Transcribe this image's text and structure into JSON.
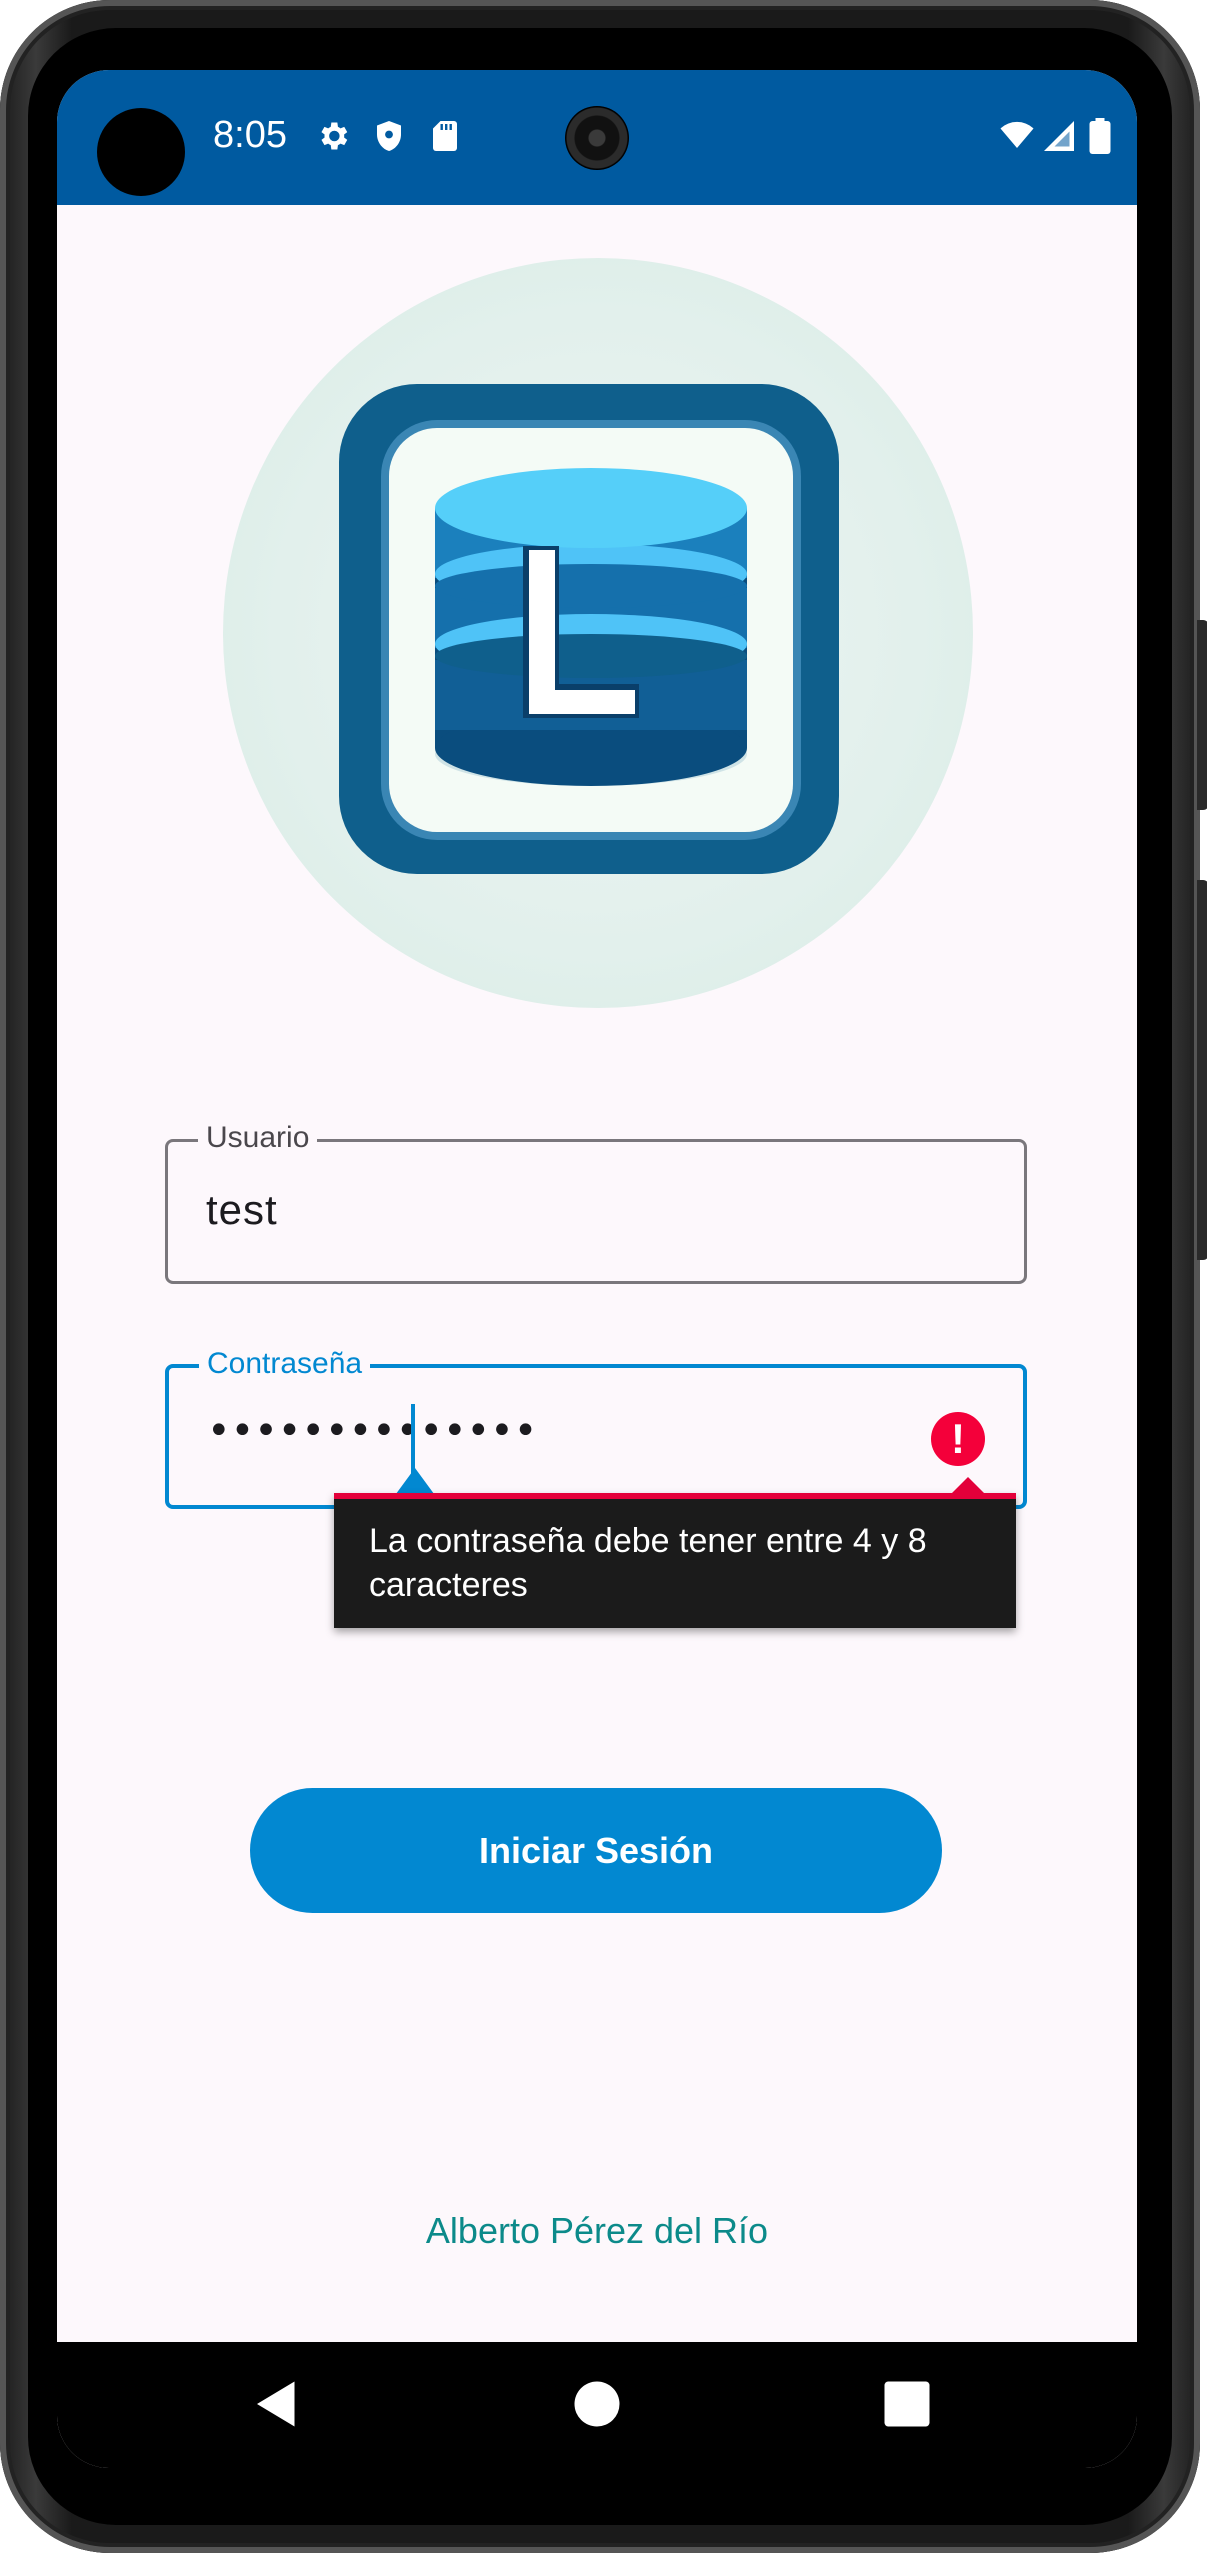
{
  "status_bar": {
    "time": "8:05",
    "left_icons": [
      "settings-icon",
      "shield-icon",
      "sd-card-icon"
    ],
    "right_icons": [
      "wifi-icon",
      "signal-icon",
      "battery-icon"
    ]
  },
  "logo": {
    "letter": "L",
    "description_icon": "database-icon"
  },
  "form": {
    "username": {
      "label": "Usuario",
      "value": "test"
    },
    "password": {
      "label": "Contraseña",
      "value": "••••••••••••••"
    },
    "error_message": "La contraseña debe tener entre 4 y 8 caracteres"
  },
  "login_button": {
    "label": "Iniciar Sesión"
  },
  "footer": {
    "author": "Alberto Pérez del Río"
  },
  "nav_bar": {
    "buttons": [
      "back-icon",
      "home-icon",
      "recents-icon"
    ]
  },
  "colors": {
    "status_bar": "#005aa0",
    "accent": "#0288d1",
    "error": "#f4003a",
    "author_text": "#0c8a8a",
    "background": "#fdf8fc"
  }
}
